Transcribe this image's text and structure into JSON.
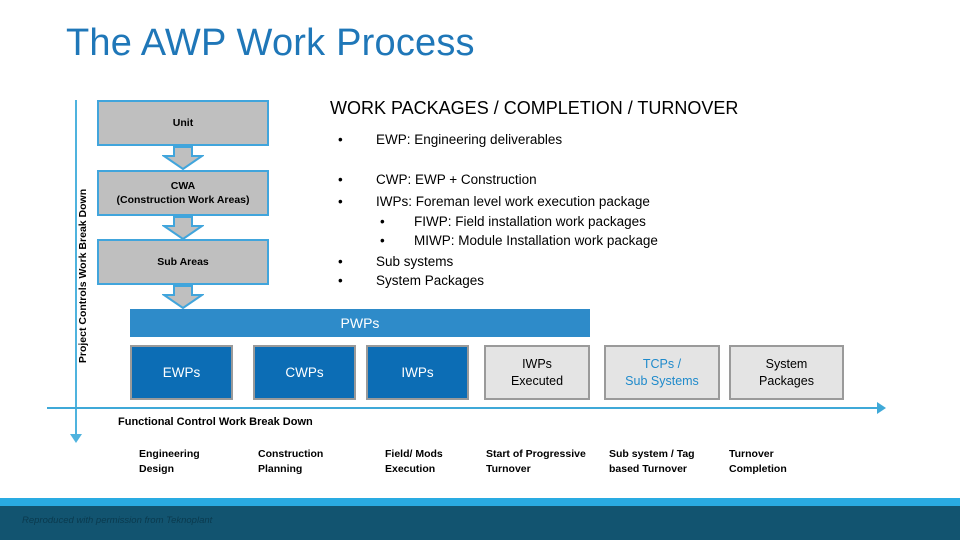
{
  "slide": {
    "title": "The AWP Work Process"
  },
  "vertical_axis": {
    "label": "Project Controls Work Break Down"
  },
  "wbs_boxes": [
    {
      "line1": "Unit",
      "line2": ""
    },
    {
      "line1": "CWA",
      "line2": "(Construction Work Areas)"
    },
    {
      "line1": "Sub Areas",
      "line2": ""
    }
  ],
  "work_packages": {
    "heading": "WORK PACKAGES / COMPLETION / TURNOVER",
    "bullets": [
      {
        "marker": "•",
        "text": "EWP: Engineering deliverables",
        "level": 1
      },
      {
        "marker": "•",
        "text": "CWP: EWP + Construction",
        "level": 1
      },
      {
        "marker": "•",
        "text": "IWPs: Foreman level work execution package",
        "level": 1
      },
      {
        "marker": "•",
        "text": "FIWP: Field installation work packages",
        "level": 2
      },
      {
        "marker": "•",
        "text": "MIWP: Module Installation work package",
        "level": 2
      },
      {
        "marker": "•",
        "text": "Sub systems",
        "level": 1
      },
      {
        "marker": "•",
        "text": "System Packages",
        "level": 1
      }
    ]
  },
  "pwps_bar": {
    "label": "PWPs"
  },
  "package_boxes": [
    {
      "line1": "EWPs",
      "line2": "",
      "style": "blue"
    },
    {
      "line1": "CWPs",
      "line2": "",
      "style": "blue"
    },
    {
      "line1": "IWPs",
      "line2": "",
      "style": "blue"
    },
    {
      "line1": "IWPs",
      "line2": "Executed",
      "style": "gray"
    },
    {
      "line1": "TCPs /",
      "line2": "Sub Systems",
      "style": "gray-accent"
    },
    {
      "line1": "System",
      "line2": "Packages",
      "style": "gray"
    }
  ],
  "functional_control": {
    "title": "Functional Control Work Break Down",
    "labels": [
      {
        "line1": "Engineering",
        "line2": "Design"
      },
      {
        "line1": "Construction",
        "line2": "Planning"
      },
      {
        "line1": "Field/ Mods",
        "line2": "Execution"
      },
      {
        "line1": "Start of Progressive",
        "line2": "Turnover"
      },
      {
        "line1": "Sub system / Tag",
        "line2": "based Turnover"
      },
      {
        "line1": "Turnover",
        "line2": "Completion"
      }
    ]
  },
  "footer": {
    "credit": "Reproduced with permission from Teknoplant"
  },
  "colors": {
    "title_blue": "#1F77B8",
    "axis_blue": "#4FB3DE",
    "box_gray": "#BFBFBF",
    "box_border_blue": "#41A5DC",
    "pwps_blue": "#2E8BC9",
    "package_blue": "#0C6DB5",
    "package_gray": "#E4E4E4",
    "accent_text_blue": "#1F8ACB",
    "footer_stripe": "#29ABE2",
    "footer_band": "#125470"
  }
}
